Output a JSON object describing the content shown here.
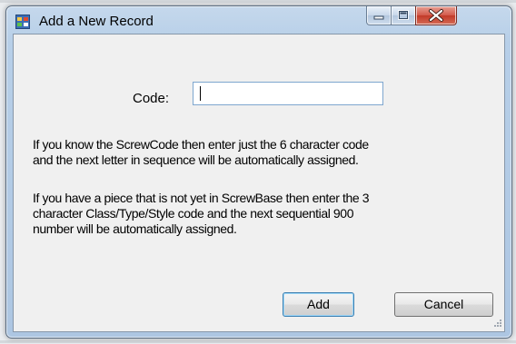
{
  "window": {
    "title": "Add a New Record",
    "app_icon": "form-icon",
    "controls": {
      "minimize_icon": "minimize-icon",
      "maximize_icon": "maximize-icon",
      "close_icon": "close-icon"
    }
  },
  "form": {
    "code_label": "Code:",
    "code_value": "",
    "paragraph1": [
      "If you know the ScrewCode then enter just the 6 character code",
      "and the next letter in sequence will be automatically assigned."
    ],
    "paragraph2": [
      "If you have a piece that is not yet in ScrewBase then enter the 3",
      "character Class/Type/Style code and the next sequential 900",
      "number will be automatically assigned."
    ]
  },
  "buttons": {
    "add_label": "Add",
    "cancel_label": "Cancel"
  },
  "colors": {
    "close_button": "#c7402e",
    "default_button_border": "#3c7fb1"
  }
}
